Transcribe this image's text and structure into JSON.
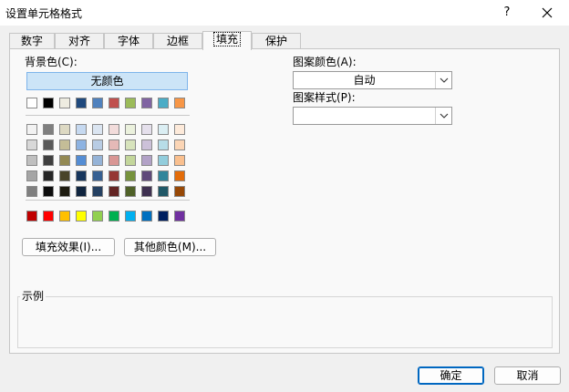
{
  "window": {
    "title": "设置单元格格式",
    "help_label": "?"
  },
  "tabs": [
    {
      "label": "数字"
    },
    {
      "label": "对齐"
    },
    {
      "label": "字体"
    },
    {
      "label": "边框"
    },
    {
      "label": "填充",
      "active": true
    },
    {
      "label": "保护"
    }
  ],
  "fill": {
    "background_label": "背景色(C):",
    "no_color_label": "无颜色",
    "fill_effects_label": "填充效果(I)...",
    "more_colors_label": "其他颜色(M)...",
    "pattern_color_label": "图案颜色(A):",
    "pattern_color_value": "自动",
    "pattern_style_label": "图案样式(P):",
    "pattern_style_value": "",
    "sample_label": "示例"
  },
  "palette": {
    "theme_top": [
      "#ffffff",
      "#000000",
      "#eeece1",
      "#1f497d",
      "#4f81bd",
      "#c0504d",
      "#9bbb59",
      "#8064a2",
      "#4bacc6",
      "#f79646"
    ],
    "theme_shades": [
      [
        "#f2f2f2",
        "#7f7f7f",
        "#ddd9c3",
        "#c6d9f0",
        "#dbe5f1",
        "#f2dcdb",
        "#ebf1dd",
        "#e5e0ec",
        "#dbeef3",
        "#fdeada"
      ],
      [
        "#d8d8d8",
        "#595959",
        "#c4bd97",
        "#8db3e2",
        "#b8cce4",
        "#e5b9b7",
        "#d7e3bc",
        "#ccc1d9",
        "#b7dde8",
        "#fbd5b5"
      ],
      [
        "#bfbfbf",
        "#3f3f3f",
        "#938953",
        "#548dd4",
        "#95b3d7",
        "#d99694",
        "#c3d69b",
        "#b2a2c7",
        "#92cddc",
        "#fac08f"
      ],
      [
        "#a5a5a5",
        "#262626",
        "#494429",
        "#17365d",
        "#366092",
        "#953734",
        "#76923c",
        "#5f497a",
        "#31859b",
        "#e36c09"
      ],
      [
        "#7f7f7f",
        "#0c0c0c",
        "#1d1b10",
        "#0f243e",
        "#244061",
        "#632423",
        "#4f6128",
        "#3f3151",
        "#205867",
        "#974806"
      ]
    ],
    "standard": [
      "#c00000",
      "#ff0000",
      "#ffc000",
      "#ffff00",
      "#92d050",
      "#00b050",
      "#00b0f0",
      "#0070c0",
      "#002060",
      "#7030a0"
    ]
  },
  "footer": {
    "ok_label": "确定",
    "cancel_label": "取消"
  }
}
